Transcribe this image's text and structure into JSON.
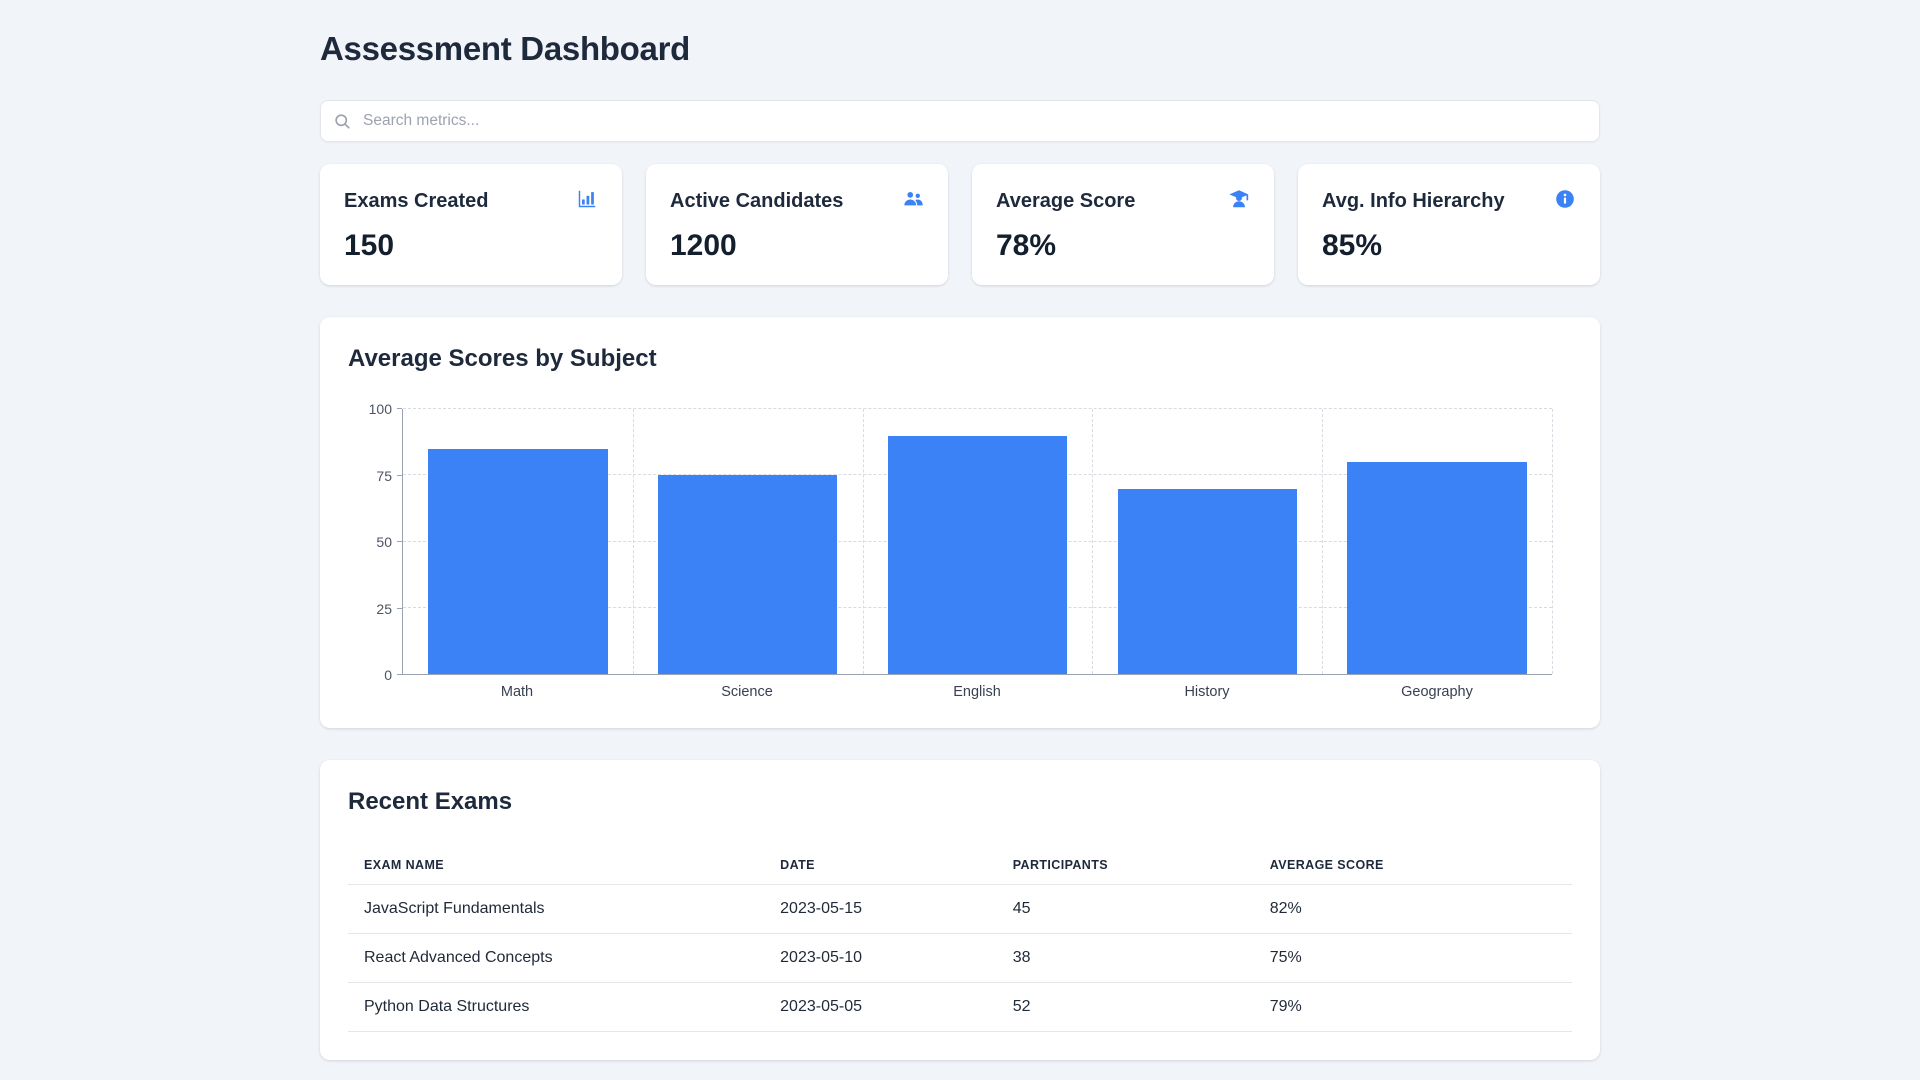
{
  "page": {
    "title": "Assessment Dashboard"
  },
  "search": {
    "placeholder": "Search metrics..."
  },
  "stats": [
    {
      "label": "Exams Created",
      "value": "150",
      "icon": "bar-chart-icon"
    },
    {
      "label": "Active Candidates",
      "value": "1200",
      "icon": "users-icon"
    },
    {
      "label": "Average Score",
      "value": "78%",
      "icon": "graduation-cap-icon"
    },
    {
      "label": "Avg. Info Hierarchy",
      "value": "85%",
      "icon": "info-icon"
    }
  ],
  "chart_data": {
    "type": "bar",
    "title": "Average Scores by Subject",
    "categories": [
      "Math",
      "Science",
      "English",
      "History",
      "Geography"
    ],
    "values": [
      85,
      75,
      90,
      70,
      80
    ],
    "ylim": [
      0,
      100
    ],
    "yticks": [
      0,
      25,
      50,
      75,
      100
    ],
    "bar_color": "#3b82f6",
    "grid": "dashed",
    "legend": "none"
  },
  "recent_exams": {
    "title": "Recent Exams",
    "columns": [
      "EXAM NAME",
      "DATE",
      "PARTICIPANTS",
      "AVERAGE SCORE"
    ],
    "rows": [
      [
        "JavaScript Fundamentals",
        "2023-05-15",
        "45",
        "82%"
      ],
      [
        "React Advanced Concepts",
        "2023-05-10",
        "38",
        "75%"
      ],
      [
        "Python Data Structures",
        "2023-05-05",
        "52",
        "79%"
      ]
    ]
  },
  "colors": {
    "accent": "#3b82f6",
    "text_dark": "#1e293b",
    "background": "#f1f4f8",
    "card": "#ffffff"
  }
}
